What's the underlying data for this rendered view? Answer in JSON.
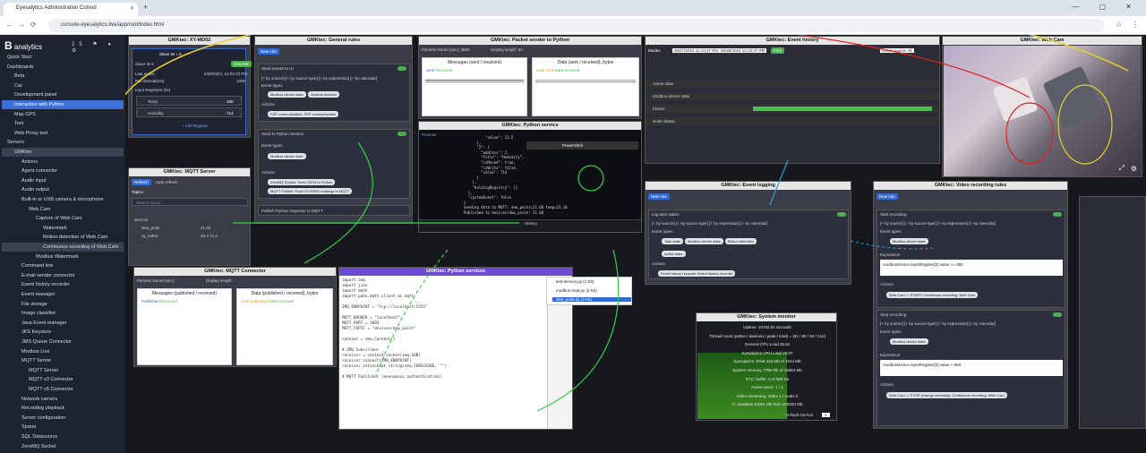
{
  "browser": {
    "tab_title": "Eyesalytics Administration Consol",
    "url": "console.eyesalytics.live/app/root/index.html"
  },
  "sidebar": {
    "logo_b": "B",
    "logo_text": "analytics",
    "top_icons": "25 ⚑ ● ⚙",
    "items": [
      "Quick Start",
      "Dashboards",
      "Beta",
      "Car",
      "Development panel",
      "Interaction with Python",
      "Map GPS",
      "Test",
      "Web Proxy test",
      "Servers",
      "GMKtec",
      "Actions",
      "Agent connector",
      "Audio input",
      "Audio output",
      "Built-in or USB camera & microphone",
      "Web Cam",
      "Capture of Web Cam",
      "Watermark",
      "Motion detection of Web Cam",
      "Continuous recording of Web Cam",
      "Modbus Watermark",
      "Command line",
      "E-mail sender connector",
      "Event history recorder",
      "Event manager",
      "File storage",
      "Image classifier",
      "Java Event manager",
      "JKS Keystore",
      "JMS Queue Connector",
      "Modbus Line",
      "MQTT Server",
      "MQTT Server",
      "MQTT v3 Connector",
      "MQTT v5 Connector",
      "Network camera",
      "Recording playback",
      "Server configuration",
      "Sparar",
      "SQL Datasource",
      "ZeroMQ Socket",
      "Issues",
      "Home"
    ]
  },
  "p_slave": {
    "title": "GMKtec: XY-MD02",
    "header": "Slave ID = 5",
    "sub": "Slave ID 5",
    "last_active_label": "Last active:",
    "last_active": "6/28/2024, 12:03:23 PM",
    "poll_label": "Poll interval(ms):",
    "poll": "1000",
    "status": "ONLINE",
    "regs_label": "Input Registers (0x)",
    "r1": "Temp",
    "v1": "280",
    "r2": "Humidity",
    "v2": "714",
    "add": "+ Add Register"
  },
  "p_rules": {
    "title": "GMKtec: General rules",
    "new": "New rule",
    "r1": "Send events to UI",
    "cond": "[+ by source] [+ by source type] [+ by expression] [+ by calendar]",
    "etypes": "Event types",
    "c1": "Modbus device state",
    "c2": "General detector",
    "actions": "Actions",
    "a1": "P2P communication: P2P communication",
    "r2": "Send to Python Service",
    "c3": "Modbus device state",
    "a2": "ZeroMQ Socket: Send JSON to Python",
    "a3": "MQTT Publish: Push XY-MD02 readings to MQTT",
    "r3": "Publish Python response to MQTT"
  },
  "p_sender": {
    "title": "GMKtec: Packet sender to Python",
    "f1": "Packets stored (sec):",
    "v1": "3600",
    "f2": "Display length:",
    "v2": "60",
    "c1": "Messages (sent / received)",
    "c2": "Data (sent / received), bytes",
    "l1": "Sent",
    "l2": "Received",
    "l3": "Data sent",
    "l4": "Data received"
  },
  "p_mqtts": {
    "title": "GMKtec: MQTT Server",
    "refresh": "Refresh",
    "auto": "Auto-refresh",
    "topics": "Topics",
    "search": "Search topics...",
    "t_root": "devices",
    "t1": "dew_point",
    "v1": "21.65",
    "t2": "xy_md02",
    "v2": "23.3 71.4"
  },
  "p_pyservice": {
    "title": "GMKtec: Python service",
    "log": "Process",
    "console": "PowerShell",
    "code": "          \"value\": 21.5\n      },\n      \"2\": {\n        \"address\": 2,\n        \"title\": \"Humidity\",\n        \"isMoved\": true,\n        \"isWrite\": false,\n        \"value\": 714\n      }\n    },\n    \"holdingRegistry\": {}\n  },\n  \"systemEvent\": false\n}\nSending data to MQTT: dew_point=21.66 temp=23.10\nPublished to devices/dew_point: 21.66",
    "history": "History"
  },
  "p_mqttc": {
    "title": "GMKtec: MQTT Connector",
    "f1": "Packets stored (sec):",
    "f2": "Display length:",
    "c1": "Messages (published / received)",
    "c2": "Data (published / received), bytes",
    "l1": "Published",
    "l2": "Received",
    "l3": "Data published",
    "l4": "Data received"
  },
  "p_pyservices": {
    "title": "GMKtec: Python services",
    "files": [
      "test-service.py (1 Kb)",
      "modbus-mqtt.py (2 Kb)",
      "dew_point.py (2 Kb)"
    ],
    "code": "import zmq\nimport json\nimport math\nimport paho.mqtt.client as mqtt\n\nZMQ_ENDPOINT = \"tcp://localhost:5555\"\n\nMQTT_BROKER = \"localhost\"\nMQTT_PORT = 1883\nMQTT_TOPIC = \"devices/dew_point\"\n\ncontext = zmq.Context()\n\n# ZMQ Subscriber\nreceiver = context.socket(zmq.SUB)\nreceiver.connect(ZMQ_ENDPOINT)\nreceiver.setsockopt_string(zmq.SUBSCRIBE, \"\")\n\n# MQTT Publisher (anonymous authentication)"
  },
  "p_events": {
    "title": "GMKtec: Event history",
    "modes": "Modes",
    "from": "06/27/2024 11:10:37 PM",
    "to": "06/28/2024 12:10:37 PM",
    "find": "Find",
    "filter": "Event source: All",
    "rows": [
      "Active state",
      "Modbus device state",
      "Motion",
      "Node Status"
    ]
  },
  "p_webcam": {
    "title": "GMKtec: Web Cam"
  },
  "p_elog": {
    "title": "GMKtec: Event logging",
    "new": "New rule",
    "r1": "Log task states",
    "cond": "[+ by source] [+ by source type] [+ by expression] [+ by calendar]",
    "etypes": "Event types",
    "c1": "Task state",
    "c2": "Modbus device state",
    "c3": "Motion detection",
    "c4": "Active state",
    "actions": "Actions",
    "a1": "Event history recorder: Event history recorder"
  },
  "p_sysmon": {
    "title": "GMKtec: System monitor",
    "lines": [
      "Uptime: 10762.91 seconds",
      "Thread count (active / daemon / peak / total) = (81 / 80 / 94 / 212)",
      "General CPU Load 25.64",
      "Eyesalytics CPU Load 25.07",
      "Eyesalytics: RAM 154 Mb of 1024 Mb",
      "System memory 7786 Mb of 15863 Mb",
      "RTC: buffer: 0 of 500 Kb",
      "Active users: 1 / 1",
      "Video streaming: Video 1 / Audio 0",
      "C: available 81551 Mb from 100020 Mb"
    ],
    "default_interval": "Default interval",
    "interval": "1"
  },
  "p_video": {
    "title": "GMKtec: Video recording rules",
    "new": "New rule",
    "r1": "Start recording",
    "cond": "[+ by source] [+ by source type] [+ by expression] [+ by calendar]",
    "etypes": "Event types",
    "c1": "Modbus device state",
    "expr": "Expression",
    "e1": "modbusDevice.inputRegister[2].value >= 850",
    "actions": "Actions",
    "a1": "Web Cam -> START: Continuous recording: Web Cam",
    "r2": "Stop recording",
    "c2": "Modbus device state",
    "e2": "modbusDevice.inputRegister[2].value < 850",
    "a2": "Web Cam -> STOP (change manually): Continuous recording: Web Cam"
  }
}
